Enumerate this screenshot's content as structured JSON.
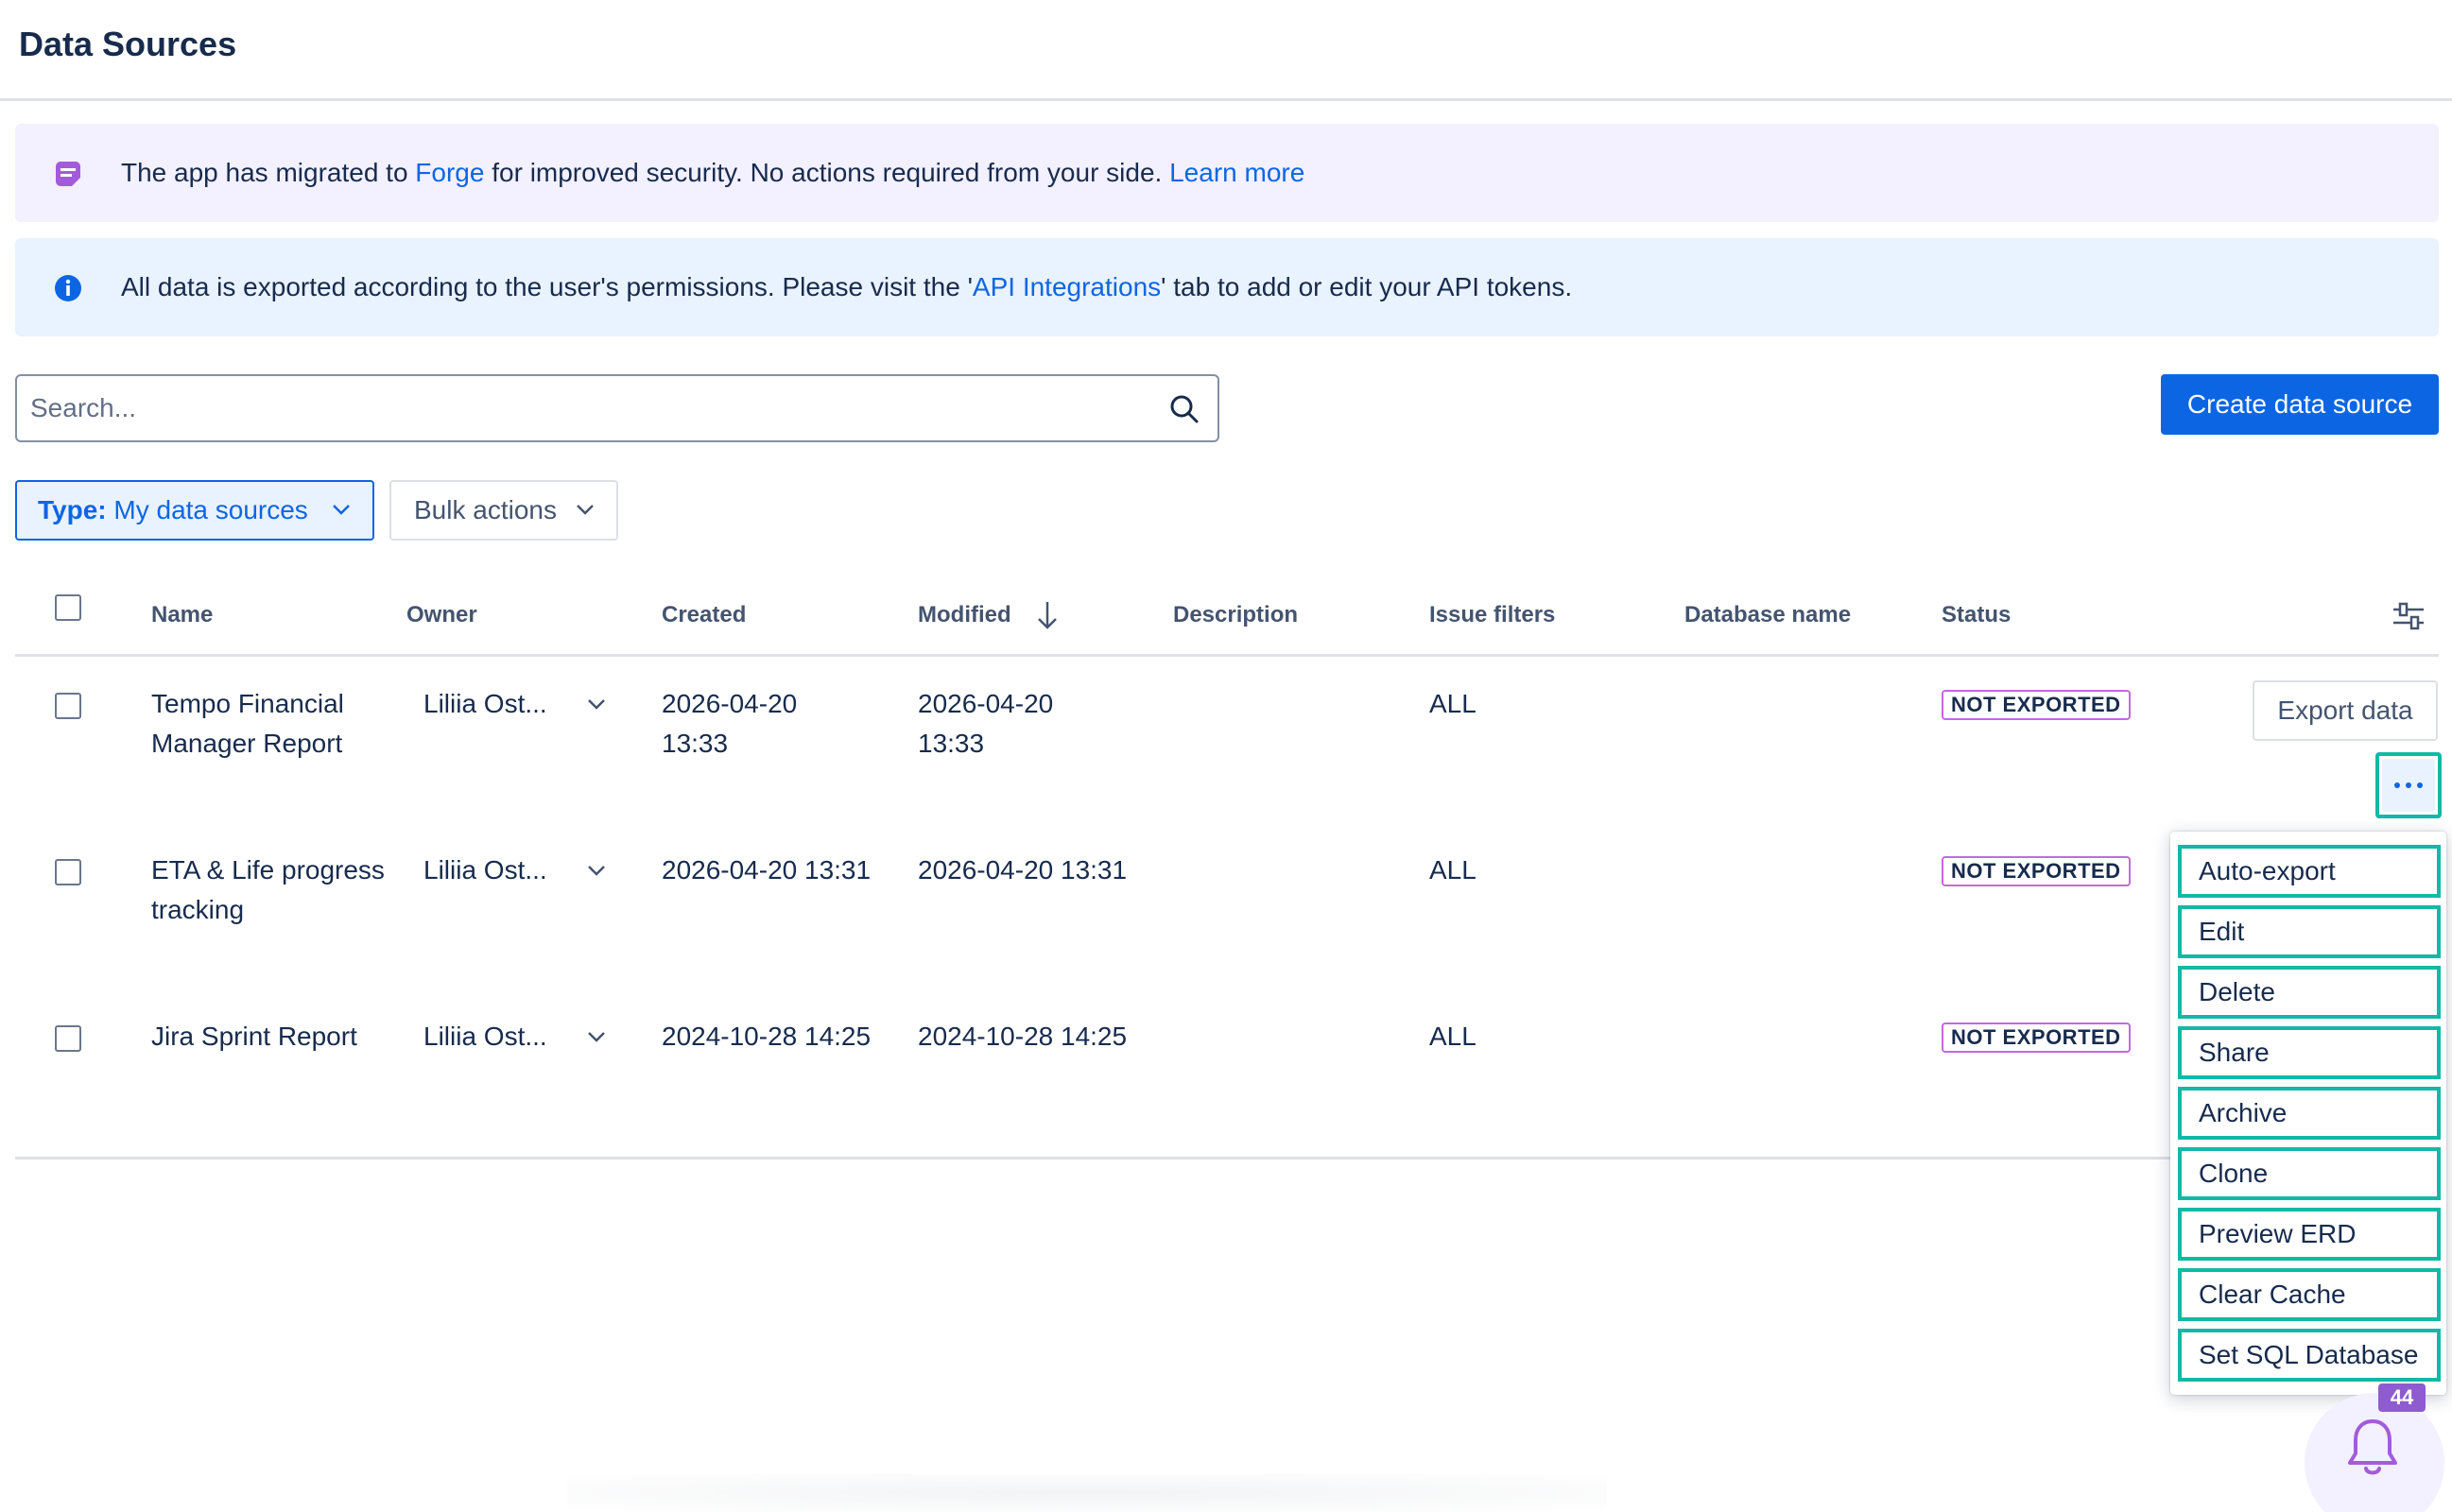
{
  "page": {
    "title": "Data Sources"
  },
  "banners": {
    "forge": {
      "text_before": "The app has migrated to ",
      "link": "Forge",
      "text_after": " for improved security. No actions required from your side. ",
      "learn_more": "Learn more",
      "icon": "forge-note-icon",
      "color": "#f3f0ff"
    },
    "info": {
      "text_before": "All data is exported according to the user's permissions. Please visit the '",
      "link": "API Integrations",
      "text_after": "' tab to add or edit your API tokens.",
      "icon": "info-icon",
      "color": "#e9f2ff"
    }
  },
  "search": {
    "placeholder": "Search...",
    "value": "",
    "icon": "search-icon"
  },
  "toolbar": {
    "create_label": "Create data source",
    "type_filter_key": "Type:",
    "type_filter_value": " My data sources",
    "bulk_label": "Bulk actions"
  },
  "table": {
    "columns": {
      "name": "Name",
      "owner": "Owner",
      "created": "Created",
      "modified": "Modified",
      "description": "Description",
      "issue_filters": "Issue filters",
      "database_name": "Database name",
      "status": "Status"
    },
    "sort_column": "Modified",
    "sort_direction": "descending",
    "rows": [
      {
        "name": "Tempo Financial Manager Report",
        "owner": "Liliia Ost...",
        "created": "2026-04-20 13:33",
        "modified": "2026-04-20 13:33",
        "description": "",
        "issue_filters": "ALL",
        "database_name": "",
        "status": "NOT EXPORTED"
      },
      {
        "name": "ETA & Life progress tracking",
        "owner": "Liliia Ost...",
        "created": "2026-04-20 13:31",
        "modified": "2026-04-20 13:31",
        "description": "",
        "issue_filters": "ALL",
        "database_name": "",
        "status": "NOT EXPORTED"
      },
      {
        "name": "Jira Sprint Report",
        "owner": "Liliia Ost...",
        "created": "2024-10-28 14:25",
        "modified": "2024-10-28 14:25",
        "description": "",
        "issue_filters": "ALL",
        "database_name": "",
        "status": "NOT EXPORTED"
      }
    ],
    "export_label": "Export data"
  },
  "actions_menu": {
    "items": [
      "Auto-export",
      "Edit",
      "Delete",
      "Share",
      "Archive",
      "Clone",
      "Preview ERD",
      "Clear Cache",
      "Set SQL Database"
    ]
  },
  "notifications": {
    "count": "44",
    "icon": "bell-icon"
  },
  "colors": {
    "primary": "#0c66e4",
    "highlight": "#14b8a6",
    "badge_border": "#c468e0",
    "notification_badge": "#8f5bd0"
  }
}
